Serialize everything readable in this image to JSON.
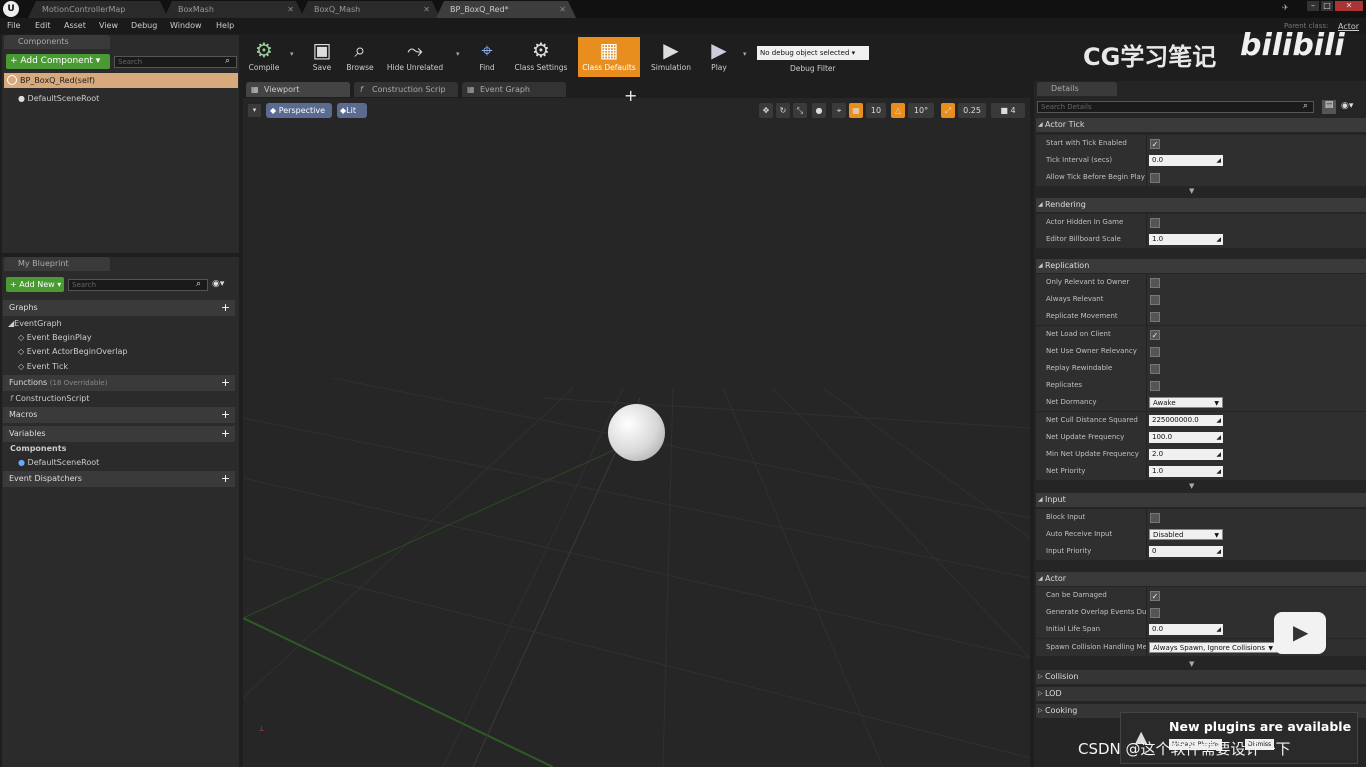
{
  "doc_tabs": [
    "MotionControllerMap",
    "BoxMash",
    "BoxQ_Mash",
    "BP_BoxQ_Red*"
  ],
  "parent_class": {
    "label": "Parent class:",
    "value": "Actor"
  },
  "menu": [
    "File",
    "Edit",
    "Asset",
    "View",
    "Debug",
    "Window",
    "Help"
  ],
  "components": {
    "tab": "Components",
    "add_button": "+ Add Component ▾",
    "search_placeholder": "Search",
    "self_item": "BP_BoxQ_Red(self)",
    "root": "DefaultSceneRoot"
  },
  "my_blueprint": {
    "tab": "My Blueprint",
    "add_new": "+ Add New ▾",
    "search_placeholder": "Search",
    "graphs_label": "Graphs",
    "event_graph": "EventGraph",
    "events": [
      "Event BeginPlay",
      "Event ActorBeginOverlap",
      "Event Tick"
    ],
    "functions_label": "Functions",
    "functions_count": "(18 Overridable)",
    "construction_script": "ConstructionScript",
    "macros_label": "Macros",
    "variables_label": "Variables",
    "components_label": "Components",
    "default_scene_root": "DefaultSceneRoot",
    "dispatchers_label": "Event Dispatchers"
  },
  "toolbar": {
    "compile": "Compile",
    "save": "Save",
    "browse": "Browse",
    "hide_unrelated": "Hide Unrelated",
    "find": "Find",
    "class_settings": "Class Settings",
    "class_defaults": "Class Defaults",
    "simulation": "Simulation",
    "play": "Play",
    "debug_select": "No debug object selected",
    "debug_filter": "Debug Filter"
  },
  "watermark": {
    "text": "CG学习笔记",
    "brand": "bilibili"
  },
  "viewport_tabs": [
    "Viewport",
    "Construction Scrip",
    "Event Graph"
  ],
  "viewport": {
    "perspective": "Perspective",
    "lit": "Lit",
    "grid_snap": "10",
    "rot_snap": "10°",
    "scale_snap": "0.25",
    "cam_speed": "4"
  },
  "details": {
    "tab": "Details",
    "search_placeholder": "Search Details",
    "sections": {
      "actor_tick": "Actor Tick",
      "rendering": "Rendering",
      "replication": "Replication",
      "input": "Input",
      "actor": "Actor",
      "collision": "Collision",
      "lod": "LOD",
      "cooking": "Cooking"
    },
    "actor_tick": [
      {
        "label": "Start with Tick Enabled",
        "checked": true
      },
      {
        "label": "Tick Interval (secs)",
        "value": "0.0"
      },
      {
        "label": "Allow Tick Before Begin Play",
        "checked": false
      }
    ],
    "rendering": [
      {
        "label": "Actor Hidden In Game",
        "checked": false
      },
      {
        "label": "Editor Billboard Scale",
        "value": "1.0"
      }
    ],
    "replication": [
      {
        "label": "Only Relevant to Owner",
        "checked": false
      },
      {
        "label": "Always Relevant",
        "checked": false
      },
      {
        "label": "Replicate Movement",
        "checked": false
      },
      {
        "label": "Net Load on Client",
        "checked": true
      },
      {
        "label": "Net Use Owner Relevancy",
        "checked": false
      },
      {
        "label": "Replay Rewindable",
        "checked": false
      },
      {
        "label": "Replicates",
        "checked": false
      },
      {
        "label": "Net Dormancy",
        "select": "Awake"
      },
      {
        "label": "Net Cull Distance Squared",
        "value": "225000000.0"
      },
      {
        "label": "Net Update Frequency",
        "value": "100.0"
      },
      {
        "label": "Min Net Update Frequency",
        "value": "2.0"
      },
      {
        "label": "Net Priority",
        "value": "1.0"
      }
    ],
    "input": [
      {
        "label": "Block Input",
        "checked": false
      },
      {
        "label": "Auto Receive Input",
        "select": "Disabled"
      },
      {
        "label": "Input Priority",
        "value": "0"
      }
    ],
    "actor": [
      {
        "label": "Can be Damaged",
        "checked": true
      },
      {
        "label": "Generate Overlap Events During Level Streaming",
        "checked": false
      },
      {
        "label": "Initial Life Span",
        "value": "0.0"
      },
      {
        "label": "Spawn Collision Handling Method",
        "select": "Always Spawn, Ignore Collisions"
      }
    ]
  },
  "notification": {
    "title": "New plugins are available",
    "manage": "Manage Plugins",
    "dismiss": "Dismiss"
  },
  "csdn_watermark": "CSDN @这个软件需要设计一下"
}
